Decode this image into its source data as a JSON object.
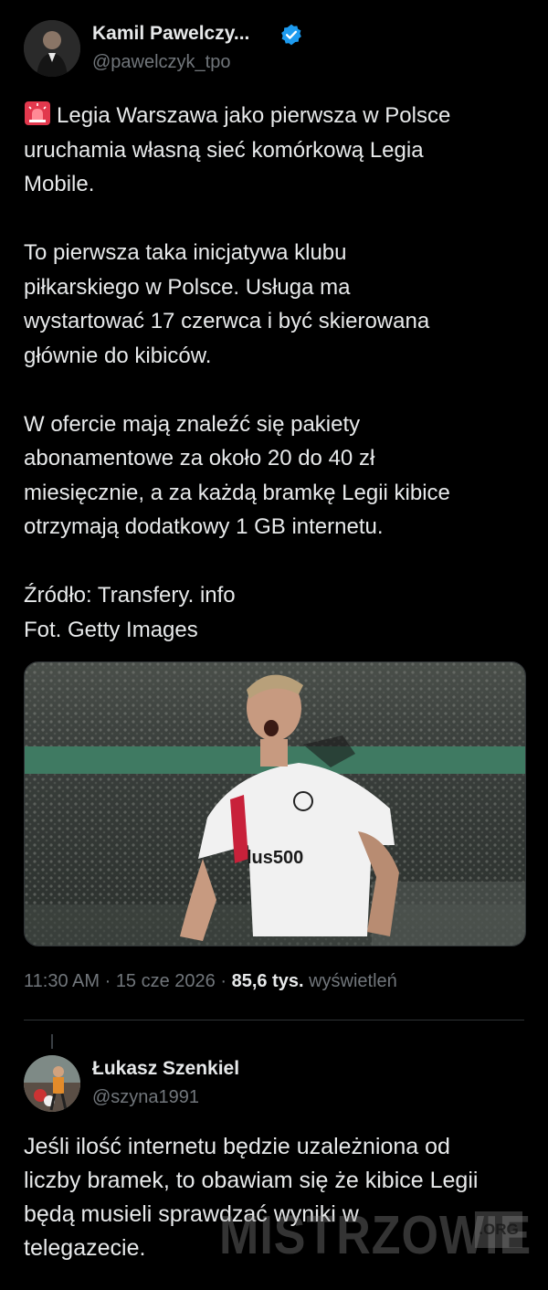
{
  "tweet": {
    "author_name": "Kamil Pawelczy...",
    "author_handle": "@pawelczyk_tpo",
    "paragraphs": [
      [
        "Legia Warszawa jako pierwsza w Polsce",
        "uruchamia własną sieć komórkową Legia",
        "Mobile."
      ],
      [
        "To pierwsza taka inicjatywa klubu",
        "piłkarskiego w Polsce. Usługa ma",
        "wystartować 17 czerwca i być skierowana",
        "głównie do kibiców."
      ],
      [
        "W ofercie mają znaleźć się pakiety",
        "abonamentowe za około 20 do 40 zł",
        "miesięcznie, a za każdą bramkę Legii kibice",
        "otrzymają dodatkowy 1 GB internetu."
      ],
      [
        "Źródło: Transfery. info",
        "Fot. Getty Images"
      ]
    ],
    "time": "11:30 AM",
    "date": "15 cze 2026",
    "views_count": "85,6 tys.",
    "views_label": "wyświetleń",
    "photo_jersey_text": "lus500"
  },
  "reply": {
    "author_name": "Łukasz Szenkiel",
    "author_handle": "@szyna1991",
    "lines": [
      "Jeśli ilość internetu będzie uzależniona od",
      "liczby bramek, to obawiam się że kibice Legii",
      "będą musieli sprawdzać wyniki w",
      "telegazecie."
    ]
  },
  "watermark": {
    "text": "MISTRZOWIE",
    "suffix": ".ORG"
  },
  "icons": {
    "verified": "verified-badge-icon",
    "siren": "police-siren-emoji-icon"
  },
  "colors": {
    "background": "#000000",
    "text": "#e7e9ea",
    "muted": "#71767b",
    "verified": "#1d9bf0"
  }
}
